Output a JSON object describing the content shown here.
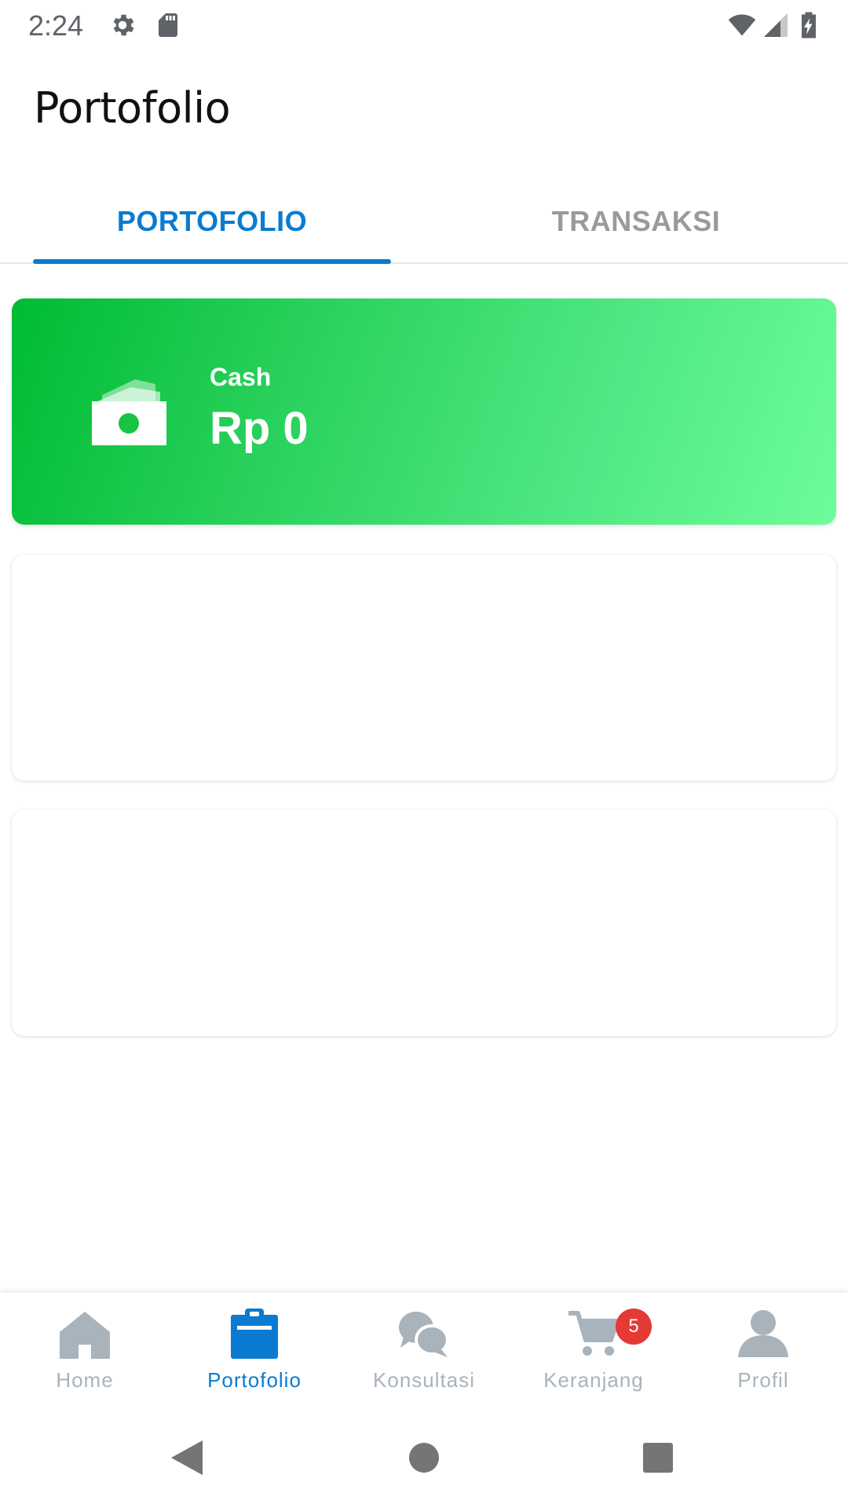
{
  "status_bar": {
    "time": "2:24",
    "icons": [
      "gear-icon",
      "sd-card-icon",
      "wifi-icon",
      "signal-icon",
      "battery-charging-icon"
    ]
  },
  "app_bar": {
    "title": "Portofolio"
  },
  "tabs": [
    {
      "label": "PORTOFOLIO",
      "active": true
    },
    {
      "label": "TRANSAKSI",
      "active": false
    }
  ],
  "cash_card": {
    "label": "Cash",
    "value": "Rp 0",
    "icon": "cash-icon"
  },
  "bottom_nav": {
    "items": [
      {
        "label": "Home",
        "icon": "home-icon",
        "active": false
      },
      {
        "label": "Portofolio",
        "icon": "clipboard-icon",
        "active": true
      },
      {
        "label": "Konsultasi",
        "icon": "chat-icon",
        "active": false
      },
      {
        "label": "Keranjang",
        "icon": "cart-icon",
        "active": false,
        "badge": "5"
      },
      {
        "label": "Profil",
        "icon": "person-icon",
        "active": false
      }
    ]
  },
  "system_nav": {
    "buttons": [
      "back-icon",
      "home-circle-icon",
      "recents-icon"
    ]
  },
  "colors": {
    "accent": "#0a7bd0",
    "cash_gradient_start": "#00bb33",
    "cash_gradient_end": "#6dfd9a",
    "inactive": "#a9b3bb",
    "badge": "#e53935"
  }
}
